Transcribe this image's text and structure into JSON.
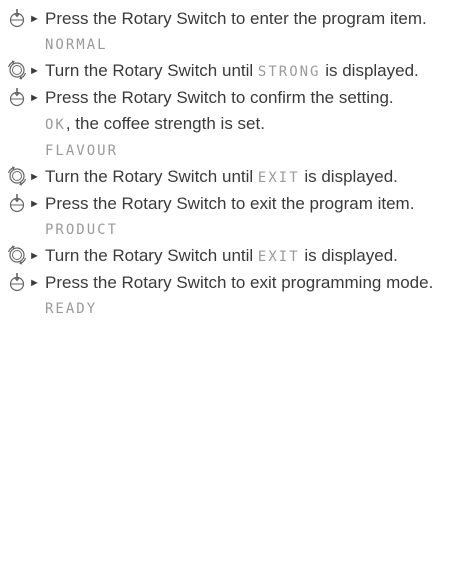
{
  "steps": [
    {
      "icon": "press-icon",
      "before": "Press the Rotary Switch to enter the program item.",
      "display": "",
      "after": "",
      "result_display": "NORMAL",
      "result_text": ""
    },
    {
      "icon": "turn-icon",
      "before": "Turn the Rotary Switch until ",
      "display": "STRONG",
      "after": " is displayed.",
      "result_display": "",
      "result_text": ""
    },
    {
      "icon": "press-icon",
      "before": "Press the Rotary Switch to confirm the setting.",
      "display": "",
      "after": "",
      "result_display": "OK",
      "result_text": ", the coffee strength is set.",
      "result_display2": "FLAVOUR"
    },
    {
      "icon": "turn-icon",
      "before": "Turn the Rotary Switch until ",
      "display": "EXIT",
      "after": " is displayed.",
      "result_display": "",
      "result_text": ""
    },
    {
      "icon": "press-icon",
      "before": "Press the Rotary Switch to exit the program item.",
      "display": "",
      "after": "",
      "result_display": "PRODUCT",
      "result_text": ""
    },
    {
      "icon": "turn-icon",
      "before": "Turn the Rotary Switch until ",
      "display": "EXIT",
      "after": " is displayed.",
      "result_display": "",
      "result_text": ""
    },
    {
      "icon": "press-icon",
      "before": "Press the Rotary Switch to exit programming mode.",
      "display": "",
      "after": "",
      "result_display": "READY",
      "result_text": ""
    }
  ],
  "bullet": "►"
}
